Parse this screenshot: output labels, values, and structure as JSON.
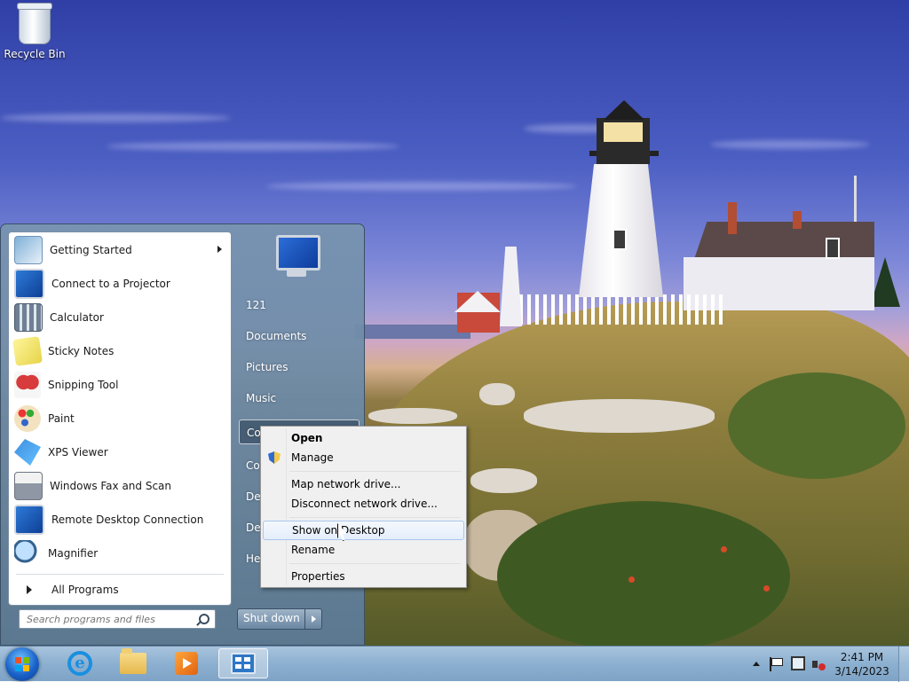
{
  "desktop": {
    "icons": [
      {
        "label": "Recycle Bin",
        "icon": "recycle-bin-icon"
      }
    ]
  },
  "start_menu": {
    "programs": [
      {
        "label": "Getting Started",
        "icon": "getting-started-icon",
        "has_submenu": true
      },
      {
        "label": "Connect to a Projector",
        "icon": "projector-icon"
      },
      {
        "label": "Calculator",
        "icon": "calculator-icon"
      },
      {
        "label": "Sticky Notes",
        "icon": "sticky-notes-icon"
      },
      {
        "label": "Snipping Tool",
        "icon": "snipping-tool-icon"
      },
      {
        "label": "Paint",
        "icon": "paint-icon"
      },
      {
        "label": "XPS Viewer",
        "icon": "xps-viewer-icon"
      },
      {
        "label": "Windows Fax and Scan",
        "icon": "fax-scan-icon"
      },
      {
        "label": "Remote Desktop Connection",
        "icon": "remote-desktop-icon"
      },
      {
        "label": "Magnifier",
        "icon": "magnifier-icon"
      }
    ],
    "all_programs_label": "All Programs",
    "search_placeholder": "Search programs and files",
    "places": [
      {
        "label": "121"
      },
      {
        "label": "Documents"
      },
      {
        "label": "Pictures"
      },
      {
        "label": "Music"
      },
      {
        "label": "Co",
        "active": true
      },
      {
        "label": "Co"
      },
      {
        "label": "Dev"
      },
      {
        "label": "Def"
      },
      {
        "label": "Hel"
      }
    ],
    "shutdown_label": "Shut down"
  },
  "context_menu": {
    "items": [
      {
        "label": "Open",
        "bold": true
      },
      {
        "label": "Manage",
        "icon": "shield-icon"
      },
      {
        "separator": true
      },
      {
        "label": "Map network drive..."
      },
      {
        "label": "Disconnect network drive..."
      },
      {
        "separator": true
      },
      {
        "label": "Show on Desktop",
        "hover": true
      },
      {
        "label": "Rename"
      },
      {
        "separator": true
      },
      {
        "label": "Properties"
      }
    ]
  },
  "taskbar": {
    "pinned": [
      {
        "name": "internet-explorer",
        "icon": "ie-icon"
      },
      {
        "name": "windows-explorer",
        "icon": "folder-icon"
      },
      {
        "name": "windows-media-player",
        "icon": "media-player-icon"
      },
      {
        "name": "control-panel",
        "icon": "control-panel-icon",
        "active": true
      }
    ],
    "clock": {
      "time": "2:41 PM",
      "date": "3/14/2023"
    }
  }
}
